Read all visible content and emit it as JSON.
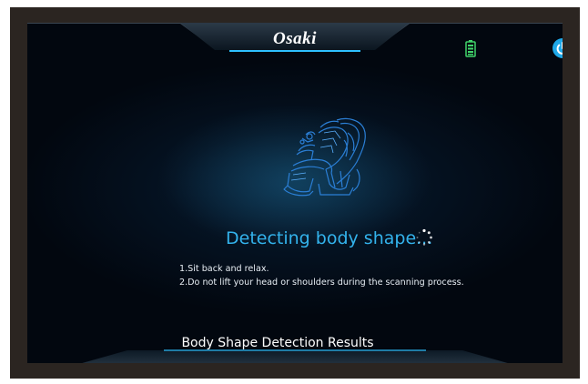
{
  "header": {
    "brand_text": "Osaki",
    "brand_dot": "•",
    "battery_icon": "battery-icon",
    "power_icon": "power-icon",
    "accent_color": "#1fa8e8"
  },
  "main": {
    "illustration": "massage-chair-outline",
    "status_text": "Detecting body shape...",
    "spinner_icon": "loading-spinner-icon",
    "status_color": "#33b3ec",
    "instructions": [
      "1.Sit back and relax.",
      "2.Do not lift your head or shoulders during the scanning process."
    ]
  },
  "footer": {
    "results_button_label": "Body Shape Detection Results"
  }
}
